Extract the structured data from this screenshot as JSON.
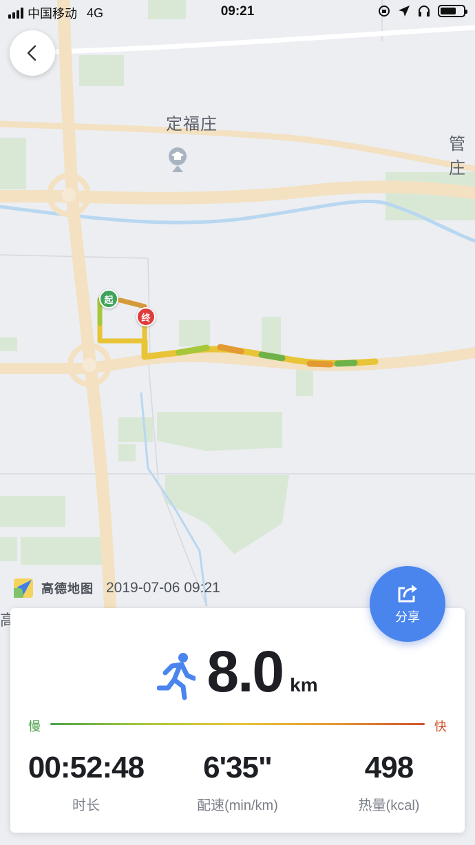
{
  "status_bar": {
    "carrier": "中国移动",
    "network": "4G",
    "time": "09:21",
    "battery_level": 0.7
  },
  "map": {
    "labels": [
      "定福庄",
      "管庄"
    ],
    "start_marker": "起",
    "end_marker": "终",
    "watermark_logo": "高德地图",
    "timestamp": "2019-07-06 09:21",
    "edge_label": "高"
  },
  "summary": {
    "distance": "8.0",
    "distance_unit": "km",
    "legend_slow": "慢",
    "legend_fast": "快",
    "stats": [
      {
        "value": "00:52:48",
        "label": "时长"
      },
      {
        "value": "6'35\"",
        "label": "配速(min/km)"
      },
      {
        "value": "498",
        "label": "热量(kcal)"
      }
    ]
  },
  "share": {
    "label": "分享"
  },
  "colors": {
    "accent": "#4a85ee",
    "start_pin": "#3fa35a",
    "end_pin": "#e03b3b",
    "route_slow": "#4aa14a",
    "route_fast": "#d0502a"
  }
}
